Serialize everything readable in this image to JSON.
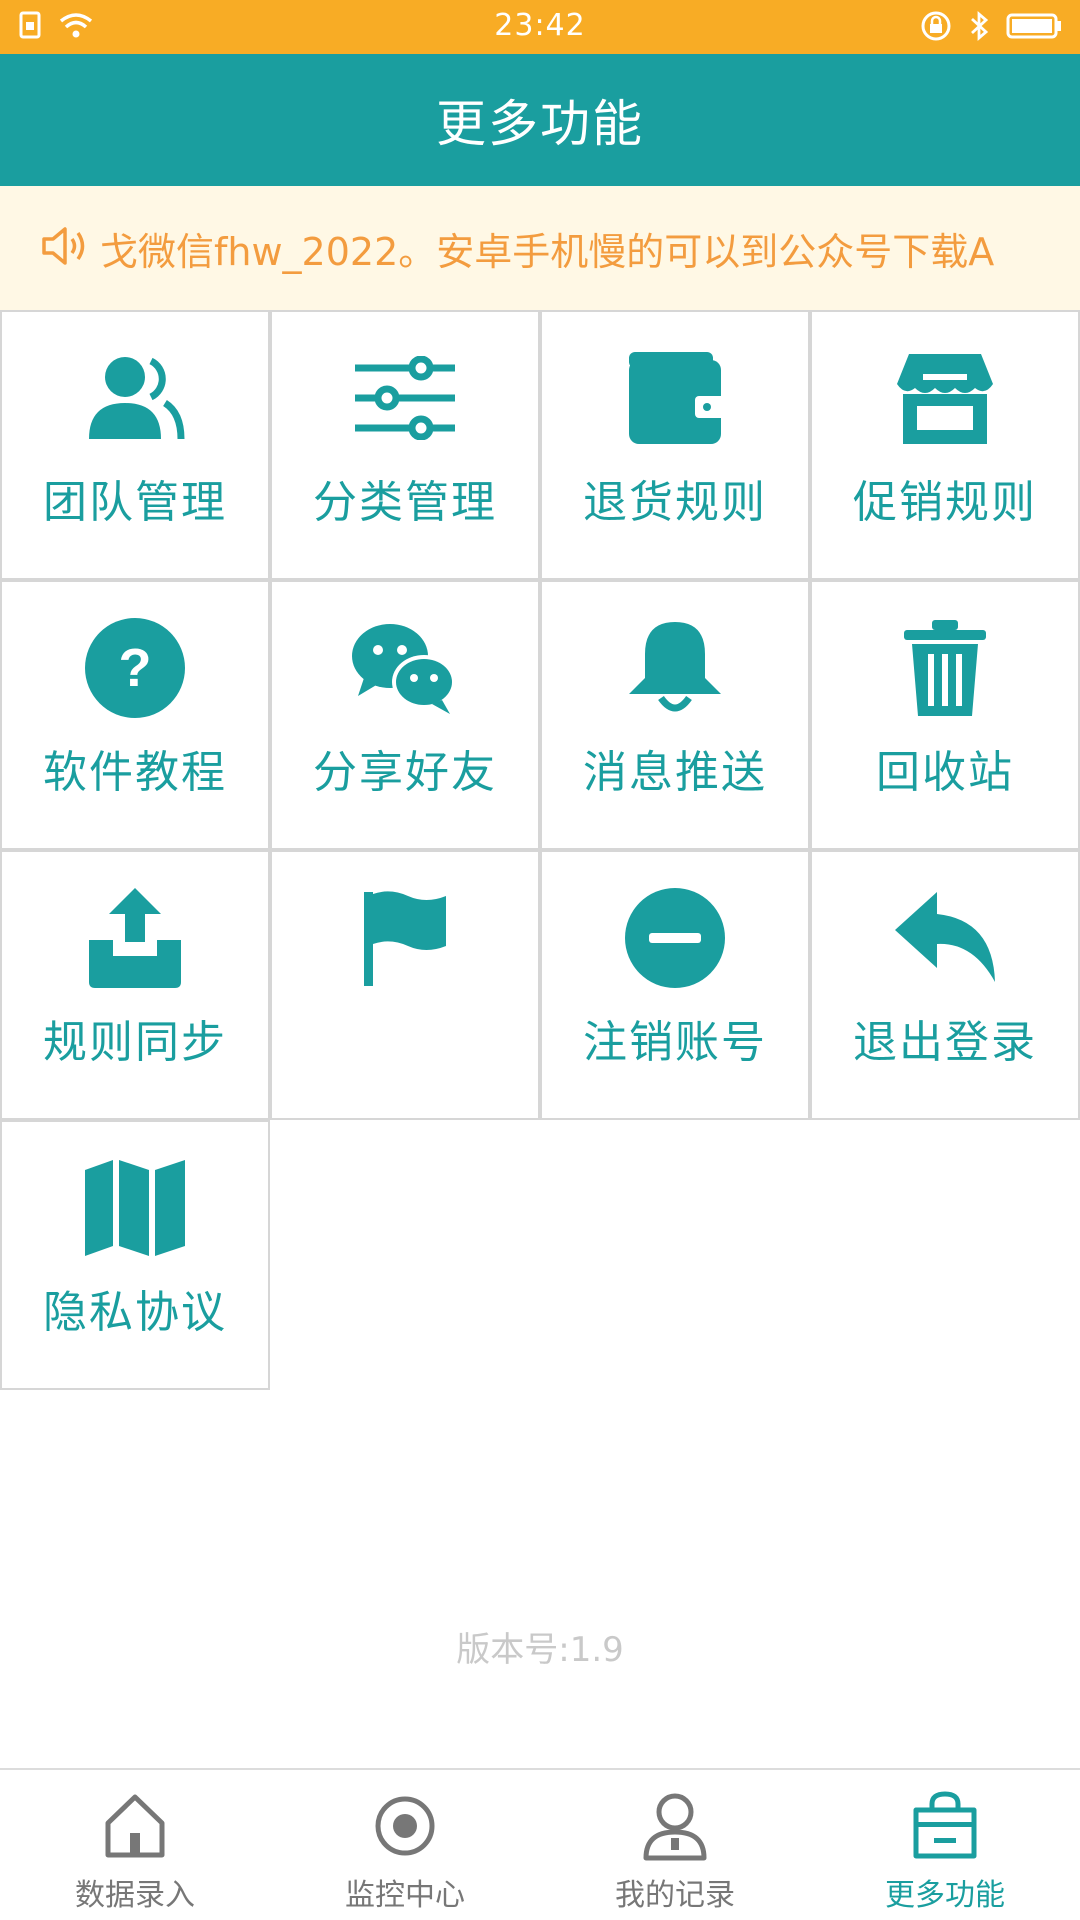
{
  "status_bar": {
    "time": "23:42",
    "left_icons": [
      "sim-card-icon",
      "wifi-icon"
    ],
    "right_icons": [
      "rotation-lock-icon",
      "bluetooth-icon",
      "battery-icon"
    ]
  },
  "app_bar": {
    "title": "更多功能"
  },
  "notice": {
    "icon": "speaker-icon",
    "text": "戈微信fhw_2022。安卓手机慢的可以到公众号下载A"
  },
  "grid": {
    "items": [
      {
        "label": "团队管理",
        "icon": "team-icon"
      },
      {
        "label": "分类管理",
        "icon": "sliders-icon"
      },
      {
        "label": "退货规则",
        "icon": "wallet-icon"
      },
      {
        "label": "促销规则",
        "icon": "store-icon"
      },
      {
        "label": "软件教程",
        "icon": "help-icon"
      },
      {
        "label": "分享好友",
        "icon": "wechat-icon"
      },
      {
        "label": "消息推送",
        "icon": "bell-icon"
      },
      {
        "label": "回收站",
        "icon": "trash-icon"
      },
      {
        "label": "规则同步",
        "icon": "upload-icon"
      },
      {
        "label": "",
        "icon": "flag-icon"
      },
      {
        "label": "注销账号",
        "icon": "minus-circle-icon"
      },
      {
        "label": "退出登录",
        "icon": "reply-icon"
      },
      {
        "label": "隐私协议",
        "icon": "map-icon"
      }
    ]
  },
  "version": {
    "label": "版本号:1.9"
  },
  "bottom_nav": {
    "items": [
      {
        "label": "数据录入",
        "icon": "home-icon",
        "active": false
      },
      {
        "label": "监控中心",
        "icon": "record-icon",
        "active": false
      },
      {
        "label": "我的记录",
        "icon": "user-icon",
        "active": false
      },
      {
        "label": "更多功能",
        "icon": "bag-icon",
        "active": true
      }
    ]
  },
  "colors": {
    "status_bar": "#f8ac25",
    "primary": "#1a9e9f",
    "notice_bg": "#fff8e5",
    "notice_text": "#f39c3f",
    "grid_border": "#d6d6d6",
    "nav_inactive": "#777777"
  }
}
